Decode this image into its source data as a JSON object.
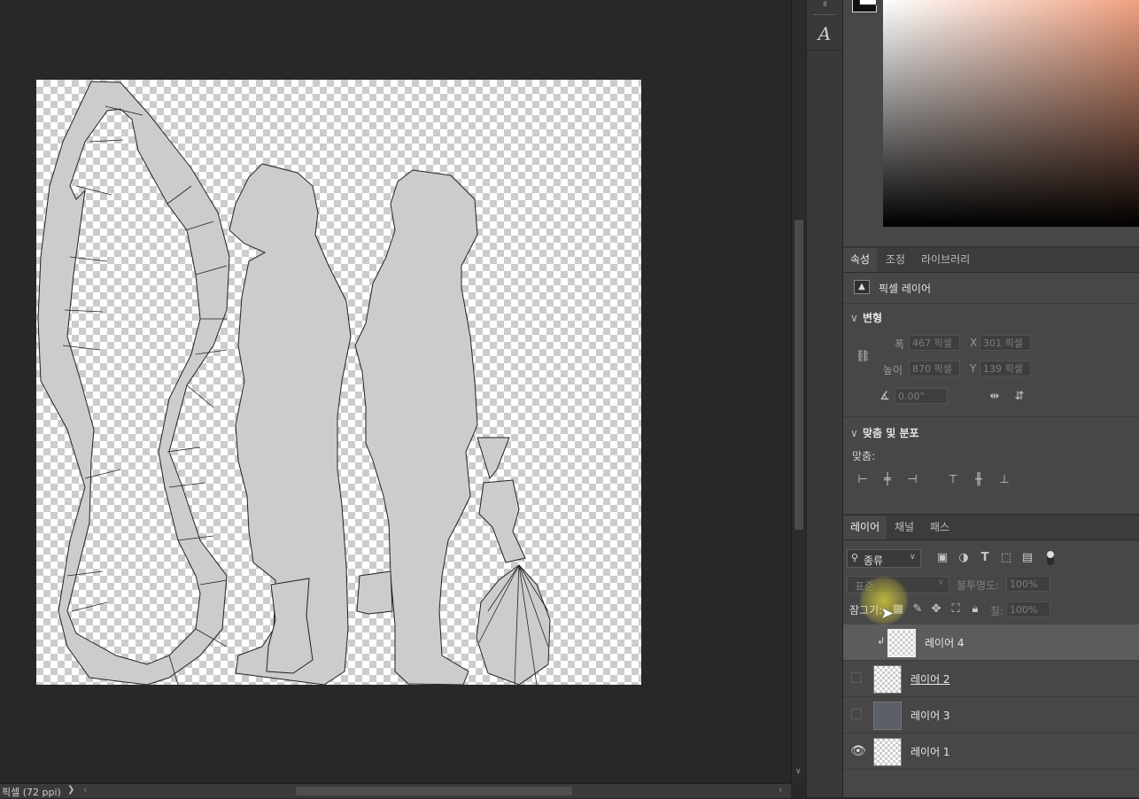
{
  "status": {
    "doc_info": "픽셀 (72 ppi)",
    "nav_arrow": "❯"
  },
  "tools": {
    "type_tool_glyph": "A"
  },
  "properties": {
    "tabs": [
      {
        "label": "속성"
      },
      {
        "label": "조정"
      },
      {
        "label": "라이브러리"
      }
    ],
    "layer_type": "픽셀 레이어",
    "transform": {
      "title": "변형",
      "width_label": "폭",
      "width_value": "467 픽셀",
      "height_label": "높이",
      "height_value": "870 픽셀",
      "x_label": "X",
      "x_value": "301 픽셀",
      "y_label": "Y",
      "y_value": "139 픽셀",
      "angle_value": "0.00°"
    },
    "align": {
      "title": "맞춤 및 분포",
      "label": "맞춤:"
    }
  },
  "layers_panel": {
    "tabs": [
      {
        "label": "레이어"
      },
      {
        "label": "채널"
      },
      {
        "label": "패스"
      }
    ],
    "filter_kind": "종류",
    "blend_mode": "표준",
    "opacity_label": "불투명도:",
    "opacity_value": "100%",
    "lock_label": "잠그기:",
    "fill_label": "칠:",
    "fill_value": "100%",
    "layers": [
      {
        "name": "레이어 4",
        "visible": false,
        "selected": true
      },
      {
        "name": "레이어 2",
        "visible": false,
        "selected": false
      },
      {
        "name": "레이어 3",
        "visible": false,
        "selected": false
      },
      {
        "name": "레이어 1",
        "visible": true,
        "selected": false
      }
    ]
  },
  "colors": {
    "accent": "#5c5c5c",
    "canvas_shape": "#cccccc",
    "panel_bg": "#474747"
  }
}
